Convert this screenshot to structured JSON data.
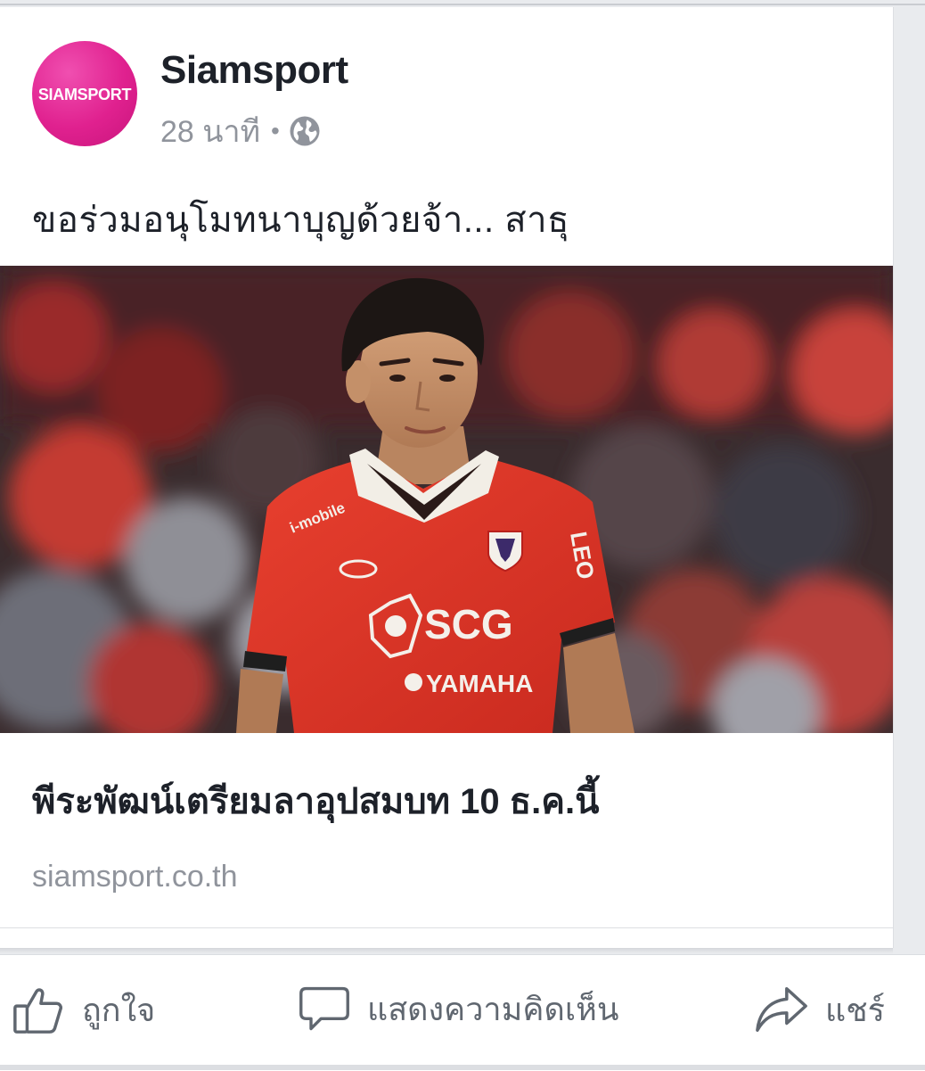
{
  "post": {
    "page_name": "Siamsport",
    "avatar_text": "SIAMSPORT",
    "timestamp": "28 นาที",
    "separator": "•",
    "privacy_icon": "globe-icon",
    "caption": "ขอร่วมอนุโมทนาบุญด้วยจ้า... สาธุ",
    "brand_color": "#e0218f"
  },
  "photo": {
    "jersey_sponsor": "SCG",
    "jersey_sub_sponsor": "YAMAHA",
    "jersey_sleeve": "i-mobile",
    "jersey_side": "LEO"
  },
  "link_preview": {
    "headline": "พีระพัฒน์เตรียมลาอุปสมบท 10 ธ.ค.นี้",
    "domain": "siamsport.co.th"
  },
  "actions": {
    "like_label": "ถูกใจ",
    "comment_label": "แสดงความคิดเห็น",
    "share_label": "แชร์",
    "like_icon": "thumbs-up-icon",
    "comment_icon": "speech-bubble-icon",
    "share_icon": "share-arrow-icon"
  }
}
